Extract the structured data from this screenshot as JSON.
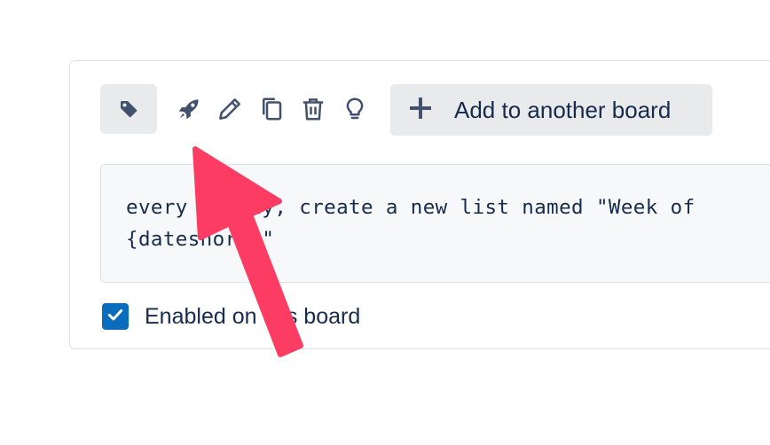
{
  "toolbar": {
    "icons": {
      "tag": "tag-icon",
      "rocket": "rocket-icon",
      "edit": "pencil-icon",
      "copy": "copy-icon",
      "delete": "trash-icon",
      "idea": "lightbulb-icon"
    },
    "add_board_label": "Add to another board"
  },
  "command": {
    "line1": "every monday, create a new list named \"Week of",
    "line2": "{dateshort}\""
  },
  "enabled": {
    "checked": true,
    "label": "Enabled on this board"
  },
  "colors": {
    "icon": "#42526e",
    "button_bg": "#e9eaec",
    "checkbox": "#0a6cbd",
    "annotation_arrow": "#fd3c64"
  }
}
